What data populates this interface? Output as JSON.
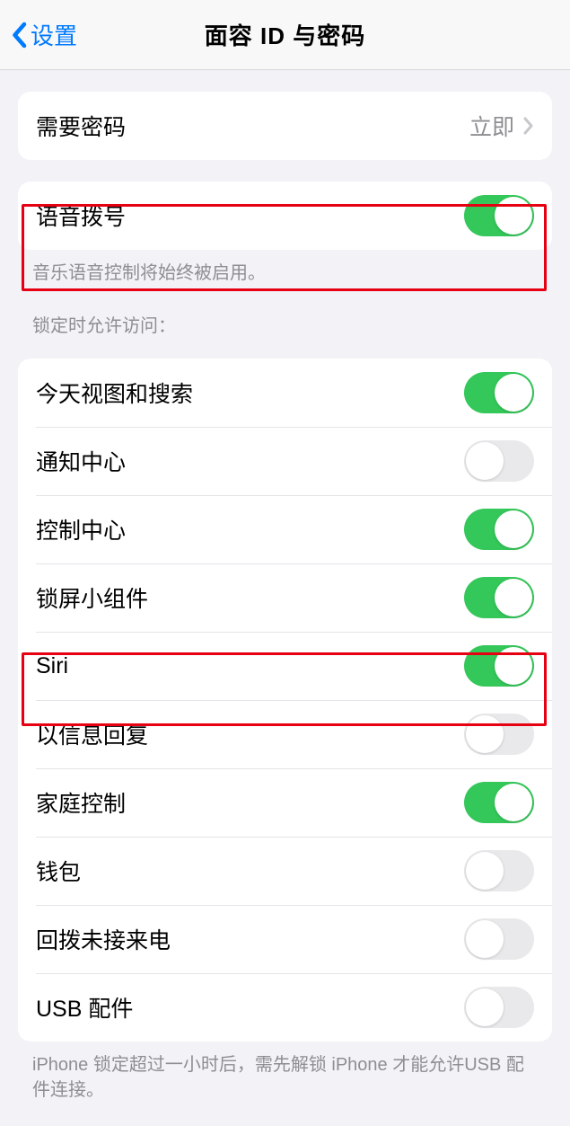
{
  "header": {
    "back_label": "设置",
    "title": "面容 ID 与密码"
  },
  "group1": {
    "row0": {
      "label": "需要密码",
      "value": "立即"
    }
  },
  "group2": {
    "row0": {
      "label": "语音拨号"
    },
    "footer": "音乐语音控制将始终被启用。"
  },
  "section3_header": "锁定时允许访问：",
  "group3": {
    "row0": {
      "label": "今天视图和搜索"
    },
    "row1": {
      "label": "通知中心"
    },
    "row2": {
      "label": "控制中心"
    },
    "row3": {
      "label": "锁屏小组件"
    },
    "row4": {
      "label": "Siri"
    },
    "row5": {
      "label": "以信息回复"
    },
    "row6": {
      "label": "家庭控制"
    },
    "row7": {
      "label": "钱包"
    },
    "row8": {
      "label": "回拨未接来电"
    },
    "row9": {
      "label": "USB 配件"
    },
    "footer": "iPhone 锁定超过一小时后，需先解锁 iPhone 才能允许USB 配件连接。"
  },
  "toggles": {
    "voice_dial": true,
    "today_view": true,
    "notification_center": false,
    "control_center": true,
    "lock_widgets": true,
    "siri": true,
    "reply_message": false,
    "home_control": true,
    "wallet": false,
    "return_missed": false,
    "usb": false
  }
}
